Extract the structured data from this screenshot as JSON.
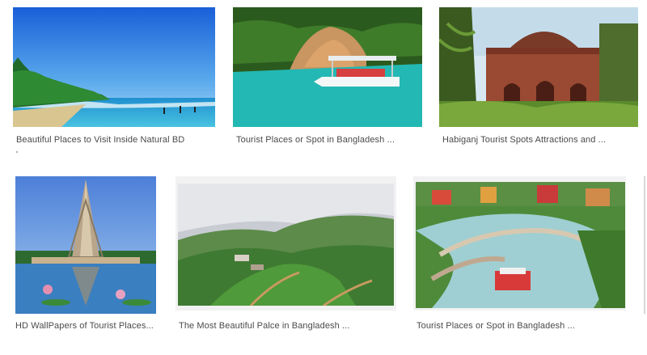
{
  "results": [
    {
      "caption": "Beautiful Places to Visit Inside Natural BD",
      "image": "beach-photo"
    },
    {
      "caption": "Tourist Places or Spot in Bangladesh ...",
      "image": "boat-lake-photo"
    },
    {
      "caption": "Habiganj Tourist Spots Attractions and ...",
      "image": "mosque-photo"
    },
    {
      "caption": "HD WallPapers of Tourist Places...",
      "image": "monument-photo"
    },
    {
      "caption": "The Most Beautiful Palce in Bangladesh ...",
      "image": "hills-photo"
    },
    {
      "caption": "Tourist Places or Spot in Bangladesh ...",
      "image": "water-park-photo"
    }
  ]
}
